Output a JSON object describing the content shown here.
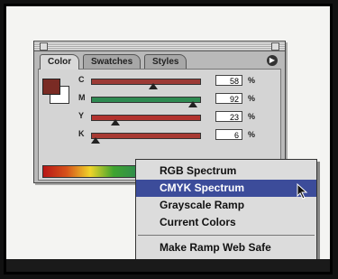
{
  "palette": {
    "tabs": [
      "Color",
      "Swatches",
      "Styles"
    ],
    "rows": [
      {
        "label": "C",
        "value": "58",
        "unit": "%",
        "color": "#9c3b36",
        "thumb": 0.58
      },
      {
        "label": "M",
        "value": "92",
        "unit": "%",
        "color": "#2e8a52",
        "thumb": 0.92
      },
      {
        "label": "Y",
        "value": "23",
        "unit": "%",
        "color": "#b2322e",
        "thumb": 0.23
      },
      {
        "label": "K",
        "value": "6",
        "unit": "%",
        "color": "#a73a33",
        "thumb": 0.06
      }
    ],
    "foreground_color": "#7a2b24"
  },
  "menu": {
    "items": [
      "RGB Spectrum",
      "CMYK Spectrum",
      "Grayscale Ramp",
      "Current Colors",
      "Make Ramp Web Safe"
    ],
    "selected": "CMYK Spectrum",
    "selected_color": "#3c4c9a"
  }
}
